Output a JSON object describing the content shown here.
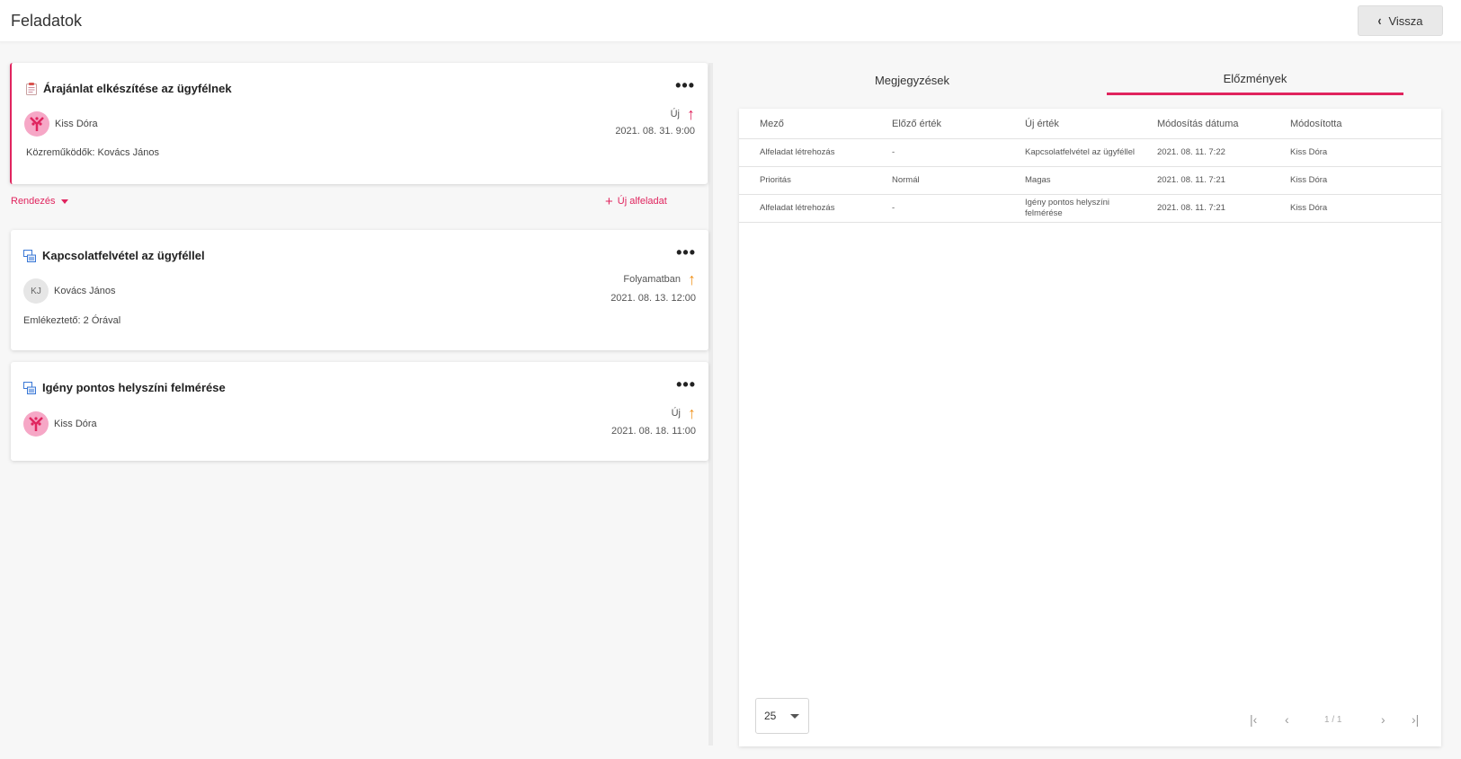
{
  "header": {
    "title": "Feladatok",
    "back_label": "Vissza"
  },
  "main_task": {
    "title": "Árajánlat elkészítése az ügyfélnek",
    "assignee": "Kiss Dóra",
    "status": "Új",
    "date": "2021. 08. 31. 9:00",
    "meta": "Közreműködők: Kovács János",
    "priority_color": "#e0245e"
  },
  "toolbar": {
    "sort_label": "Rendezés",
    "new_subtask_label": "Új alfeladat"
  },
  "subtasks": [
    {
      "title": "Kapcsolatfelvétel az ügyféllel",
      "assignee": "Kovács János",
      "initials": "KJ",
      "status": "Folyamatban",
      "date": "2021. 08. 13. 12:00",
      "meta": "Emlékeztető: 2 Órával",
      "priority_color": "#f0931e"
    },
    {
      "title": "Igény pontos helyszíni felmérése",
      "assignee": "Kiss Dóra",
      "status": "Új",
      "date": "2021. 08. 18. 11:00",
      "priority_color": "#f0931e"
    }
  ],
  "tabs": [
    {
      "label": "Megjegyzések",
      "active": false
    },
    {
      "label": "Előzmények",
      "active": true
    }
  ],
  "history_table": {
    "columns": [
      "Mező",
      "Előző érték",
      "Új érték",
      "Módosítás dátuma",
      "Módosította"
    ],
    "rows": [
      [
        "Alfeladat létrehozás",
        "-",
        "Kapcsolatfelvétel az ügyféllel",
        "2021. 08. 11. 7:22",
        "Kiss Dóra"
      ],
      [
        "Prioritás",
        "Normál",
        "Magas",
        "2021. 08. 11. 7:21",
        "Kiss Dóra"
      ],
      [
        "Alfeladat létrehozás",
        "-",
        "Igény pontos helyszíni felmérése",
        "2021. 08. 11. 7:21",
        "Kiss Dóra"
      ]
    ]
  },
  "pagination": {
    "page_size": "25",
    "page_info": "1 / 1"
  },
  "icons": {
    "more": "more-horizontal-icon",
    "back": "chevron-left-icon",
    "priority": "arrow-up-icon",
    "task": "task-document-icon",
    "subtask": "subtask-icon"
  }
}
